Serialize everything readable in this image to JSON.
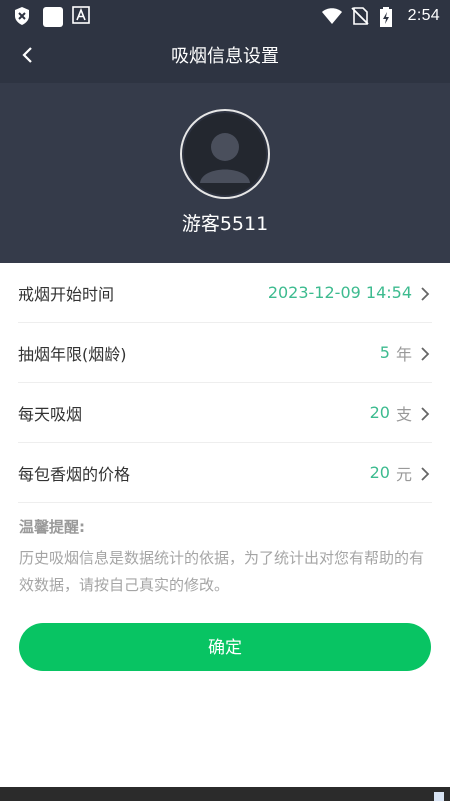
{
  "status_bar": {
    "time": "2:54",
    "left_icons": [
      "shield-x-icon",
      "white-square-icon",
      "a-badge-icon"
    ],
    "right_icons": [
      "wifi-icon",
      "no-sim-icon",
      "battery-charging-icon"
    ]
  },
  "header": {
    "title": "吸烟信息设置",
    "back_icon": "chevron-left-icon"
  },
  "profile": {
    "username": "游客5511",
    "avatar_icon": "default-avatar-icon"
  },
  "settings": [
    {
      "label": "戒烟开始时间",
      "value": "2023-12-09 14:54",
      "unit": ""
    },
    {
      "label": "抽烟年限(烟龄)",
      "value": "5",
      "unit": "年"
    },
    {
      "label": "每天吸烟",
      "value": "20",
      "unit": "支"
    },
    {
      "label": "每包香烟的价格",
      "value": "20",
      "unit": "元"
    }
  ],
  "tips": {
    "title": "温馨提醒:",
    "text": "历史吸烟信息是数据统计的依据，为了统计出对您有帮助的有效数据，请按自己真实的修改。"
  },
  "confirm_label": "确定",
  "colors": {
    "header_bg": "#2e3442",
    "profile_bg": "#353b4a",
    "value_green": "#3dbb8f",
    "button_green": "#08c463"
  }
}
